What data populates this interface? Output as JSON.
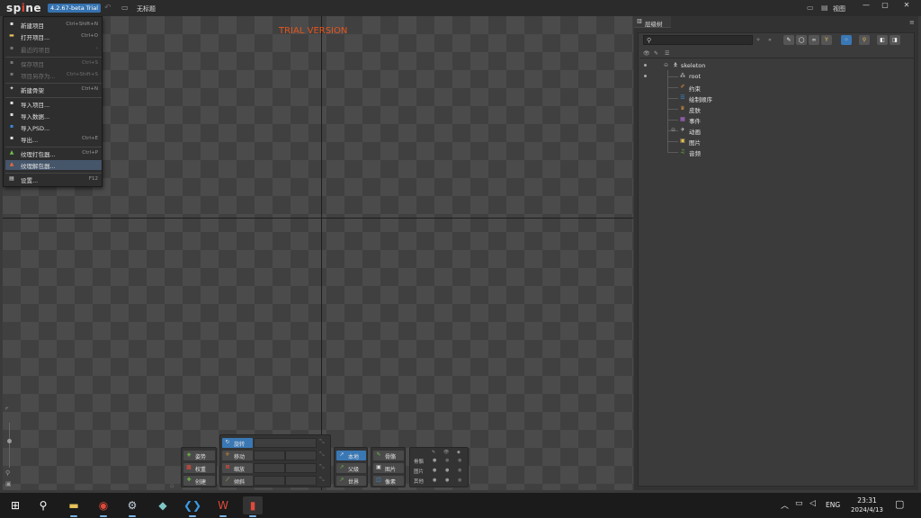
{
  "app": {
    "logo_prefix": "sp",
    "logo_dot": "i",
    "logo_suffix": "ne",
    "version": "4.2.67-beta Trial",
    "project_title": "无标题",
    "view_label": "视图",
    "watermark": "TRIAL VERSION"
  },
  "file_menu": {
    "items": [
      {
        "label": "新建项目",
        "shortcut": "Ctrl+Shift+N",
        "icon": "new-project-icon",
        "color": "#e0e0e0",
        "disabled": false
      },
      {
        "label": "打开项目...",
        "shortcut": "Ctrl+O",
        "icon": "open-folder-icon",
        "color": "#e8c25a",
        "disabled": false
      },
      {
        "label": "最近的项目",
        "shortcut": "›",
        "icon": "recent-icon",
        "color": "#777777",
        "disabled": true
      },
      {
        "label": "保存项目",
        "shortcut": "Ctrl+S",
        "icon": "save-icon",
        "color": "#777777",
        "disabled": true
      },
      {
        "label": "项目另存为...",
        "shortcut": "Ctrl+Shift+S",
        "icon": "save-as-icon",
        "color": "#777777",
        "disabled": true
      },
      {
        "label": "新建骨架",
        "shortcut": "Ctrl+N",
        "icon": "new-skeleton-icon",
        "color": "#e0e0e0",
        "disabled": false
      },
      {
        "label": "导入项目...",
        "shortcut": "",
        "icon": "import-project-icon",
        "color": "#e0e0e0",
        "disabled": false
      },
      {
        "label": "导入数据...",
        "shortcut": "",
        "icon": "import-data-icon",
        "color": "#e0e0e0",
        "disabled": false
      },
      {
        "label": "导入PSD...",
        "shortcut": "",
        "icon": "import-psd-icon",
        "color": "#3a8ad8",
        "disabled": false
      },
      {
        "label": "导出...",
        "shortcut": "Ctrl+E",
        "icon": "export-icon",
        "color": "#e0e0e0",
        "disabled": false
      },
      {
        "label": "纹理打包器...",
        "shortcut": "Ctrl+P",
        "icon": "texture-packer-icon",
        "color": "#6fbf4a",
        "disabled": false
      },
      {
        "label": "纹理解包器...",
        "shortcut": "",
        "icon": "texture-unpacker-icon",
        "color": "#e26a3a",
        "disabled": false
      },
      {
        "label": "设置...",
        "shortcut": "F12",
        "icon": "settings-icon",
        "color": "#e0e0e0",
        "disabled": false
      }
    ]
  },
  "toolbar": {
    "pose_group": [
      {
        "label": "姿势",
        "icon": "pose-icon"
      },
      {
        "label": "权重",
        "icon": "weights-icon"
      },
      {
        "label": "创建",
        "icon": "create-icon"
      }
    ],
    "transform_group": [
      {
        "label": "旋转",
        "icon": "rotate-icon",
        "active": true
      },
      {
        "label": "移动",
        "icon": "translate-icon",
        "active": false
      },
      {
        "label": "缩放",
        "icon": "scale-icon",
        "active": false
      },
      {
        "label": "倾斜",
        "icon": "shear-icon",
        "active": false
      }
    ],
    "axes_group": [
      {
        "label": "本地",
        "icon": "local-icon",
        "active": true
      },
      {
        "label": "父级",
        "icon": "parent-icon",
        "active": false
      },
      {
        "label": "世界",
        "icon": "world-icon",
        "active": false
      }
    ],
    "compensate_group": [
      {
        "label": "骨骼",
        "icon": "bones-icon"
      },
      {
        "label": "图片",
        "icon": "images-icon"
      },
      {
        "label": "像素",
        "icon": "pixels-icon"
      }
    ],
    "options_grid": {
      "rows": [
        "骨骼",
        "图片",
        "其他"
      ],
      "columns": [
        "select-icon",
        "visibility-icon",
        "name-tag-icon"
      ]
    }
  },
  "tree": {
    "tab_label": "层级树",
    "search_placeholder": "",
    "root_node": "skeleton",
    "children": [
      {
        "label": "root",
        "icon": "bone-icon",
        "color": "#d8d8d8"
      },
      {
        "label": "约束",
        "icon": "constraints-icon",
        "color": "#e2923a"
      },
      {
        "label": "绘制顺序",
        "icon": "draw-order-icon",
        "color": "#3a8ad8"
      },
      {
        "label": "皮肤",
        "icon": "skins-icon",
        "color": "#e2923a"
      },
      {
        "label": "事件",
        "icon": "events-icon",
        "color": "#b56ad8"
      },
      {
        "label": "动画",
        "icon": "animations-icon",
        "color": "#d8d8d8"
      },
      {
        "label": "图片",
        "icon": "images-folder-icon",
        "color": "#e8c25a"
      },
      {
        "label": "音频",
        "icon": "audio-icon",
        "color": "#6fbf4a"
      }
    ]
  },
  "taskbar": {
    "apps": [
      {
        "name": "start-icon",
        "glyph": "⊞",
        "color": "#ffffff"
      },
      {
        "name": "search-icon",
        "glyph": "⚲",
        "color": "#ffffff"
      },
      {
        "name": "file-explorer-icon",
        "glyph": "▬",
        "color": "#e8c25a"
      },
      {
        "name": "chrome-icon",
        "glyph": "◉",
        "color": "#e04a3a"
      },
      {
        "name": "steam-icon",
        "glyph": "⚙",
        "color": "#c6d4df"
      },
      {
        "name": "notes-icon",
        "glyph": "◆",
        "color": "#7fc7c7"
      },
      {
        "name": "vscode-icon",
        "glyph": "❮❯",
        "color": "#3a9ae8"
      },
      {
        "name": "wps-icon",
        "glyph": "W",
        "color": "#e04a3a"
      },
      {
        "name": "spine-icon",
        "glyph": "▮",
        "color": "#e04a3a"
      }
    ],
    "language": "ENG",
    "time": "23:31",
    "date": "2024/4/13"
  }
}
